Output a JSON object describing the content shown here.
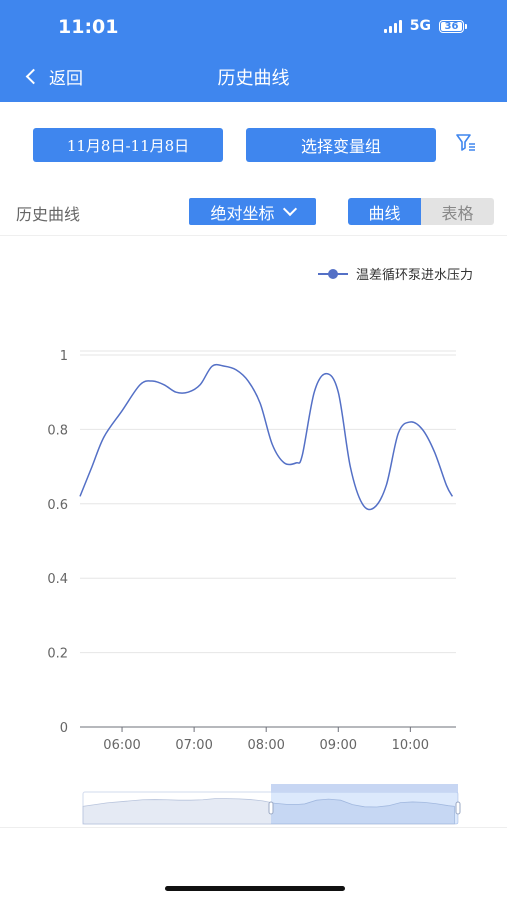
{
  "status": {
    "time": "11:01",
    "network": "5G",
    "battery": "36"
  },
  "nav": {
    "back_label": "返回",
    "title": "历史曲线"
  },
  "toolbar": {
    "date_range": "11月8日-11月8日",
    "group_button": "选择变量组"
  },
  "controls": {
    "label": "历史曲线",
    "coord_mode": "绝对坐标",
    "tab_curve": "曲线",
    "tab_table": "表格"
  },
  "colors": {
    "primary": "#3f86ee",
    "line": "#5470c6"
  },
  "chart_data": {
    "type": "line",
    "series": [
      {
        "name": "温差循环泵进水压力",
        "x": [
          "05:25",
          "05:35",
          "05:45",
          "06:00",
          "06:15",
          "06:25",
          "06:35",
          "06:45",
          "06:55",
          "07:05",
          "07:15",
          "07:25",
          "07:35",
          "07:45",
          "07:55",
          "08:05",
          "08:15",
          "08:25",
          "08:30",
          "08:40",
          "08:50",
          "09:00",
          "09:10",
          "09:20",
          "09:30",
          "09:40",
          "09:50",
          "10:00",
          "10:10",
          "10:20",
          "10:30",
          "10:35"
        ],
        "values": [
          0.62,
          0.7,
          0.78,
          0.85,
          0.92,
          0.93,
          0.92,
          0.9,
          0.9,
          0.92,
          0.97,
          0.97,
          0.96,
          0.93,
          0.87,
          0.76,
          0.71,
          0.71,
          0.73,
          0.9,
          0.95,
          0.9,
          0.7,
          0.6,
          0.59,
          0.65,
          0.79,
          0.82,
          0.8,
          0.74,
          0.65,
          0.62
        ]
      }
    ],
    "x_ticks": [
      "06:00",
      "07:00",
      "08:00",
      "09:00",
      "10:00"
    ],
    "y_ticks": [
      "0",
      "0.2",
      "0.4",
      "0.6",
      "0.8",
      "1"
    ],
    "ylim": [
      0,
      1
    ],
    "grid": true,
    "legend": "top-right"
  }
}
